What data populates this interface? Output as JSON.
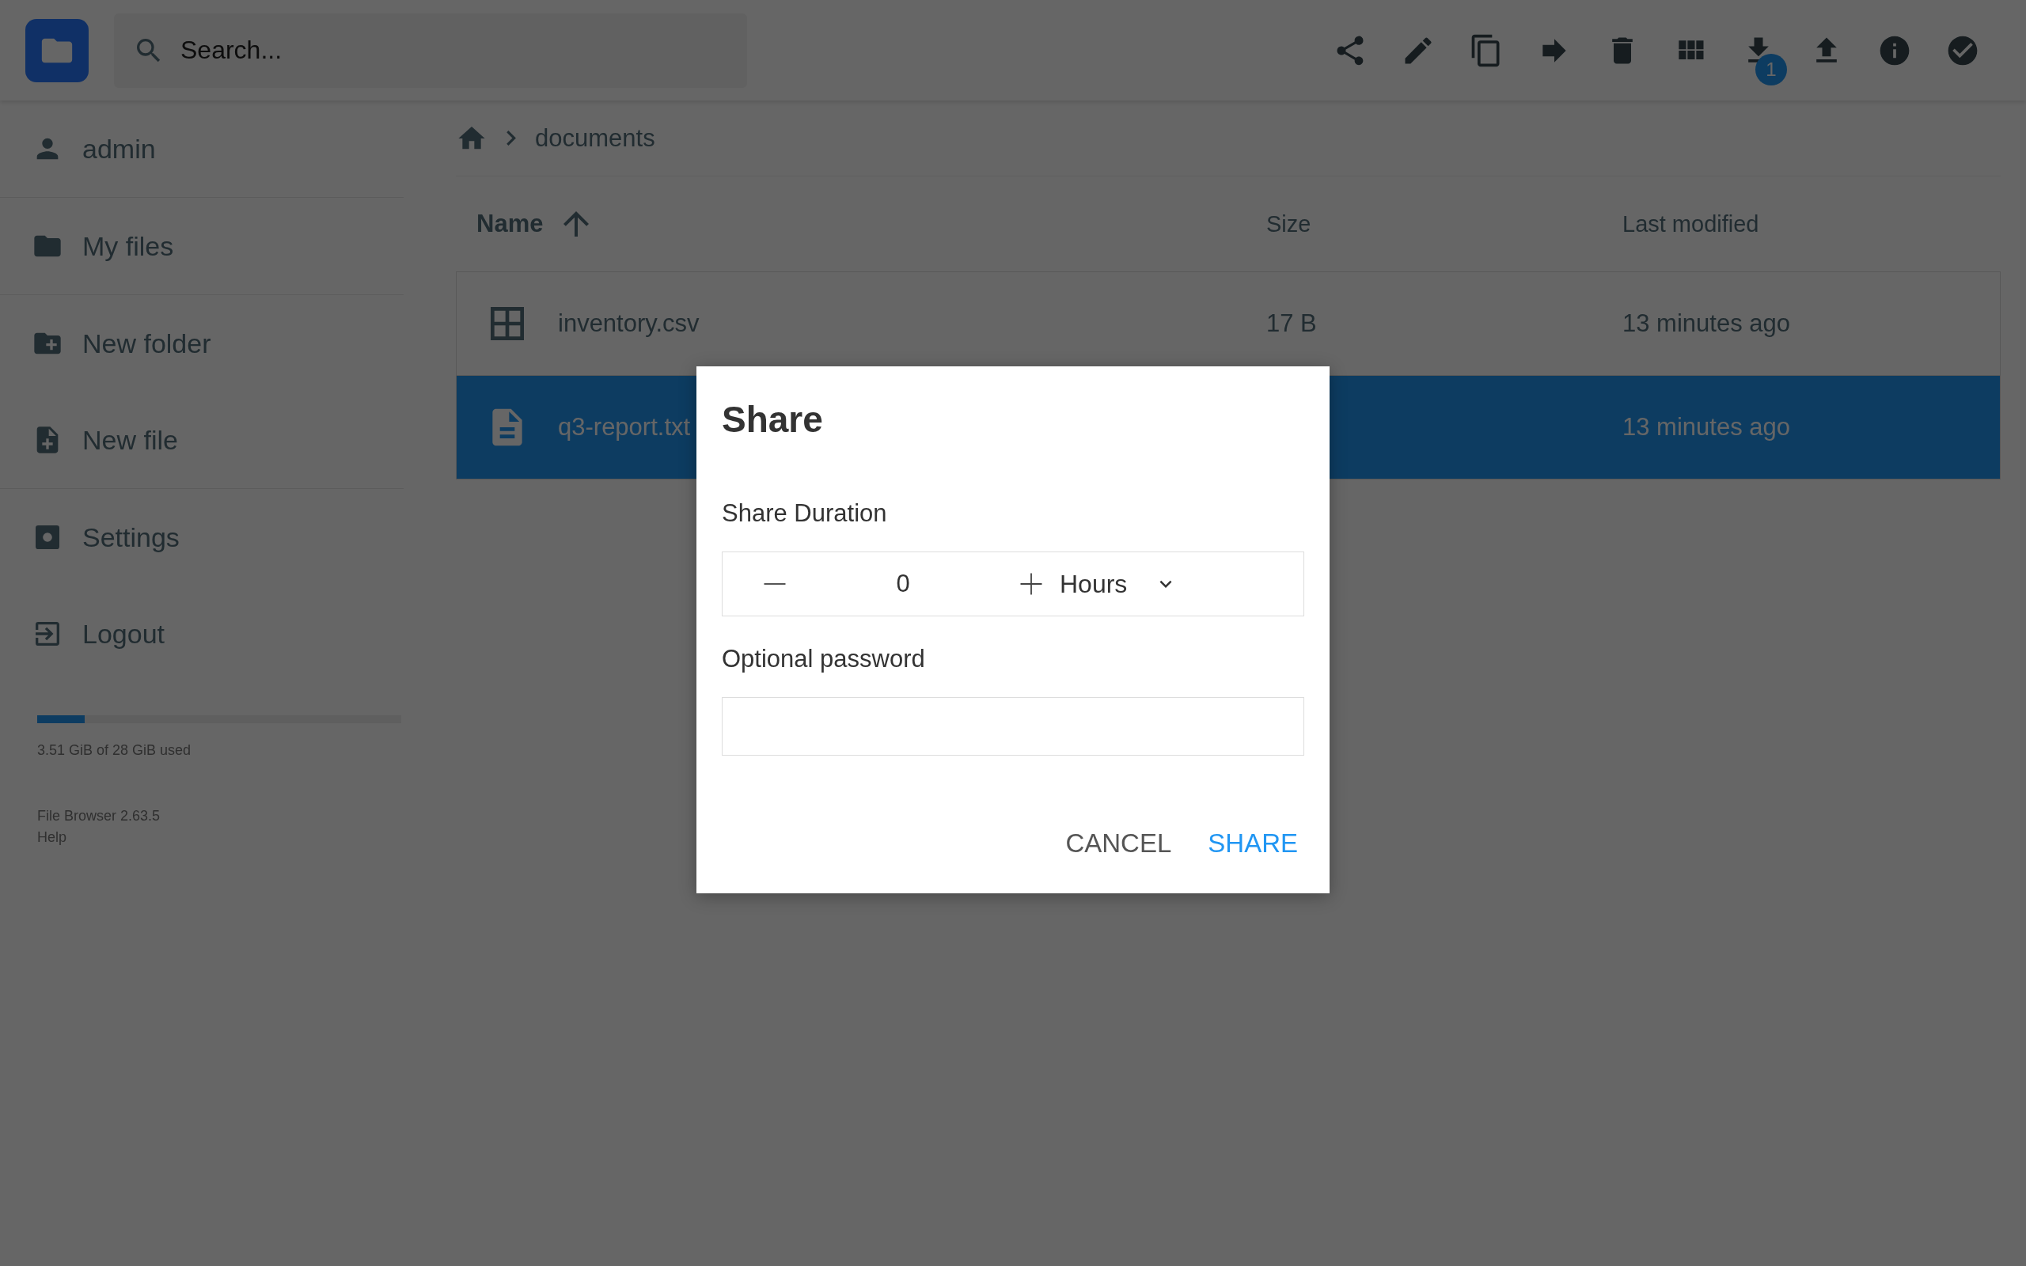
{
  "header": {
    "search": {
      "placeholder": "Search..."
    },
    "download_badge": "1"
  },
  "sidebar": {
    "user": "admin",
    "groups": [
      [
        {
          "label": "My files",
          "kind": "folder"
        }
      ],
      [
        {
          "label": "New folder",
          "kind": "new-folder"
        },
        {
          "label": "New file",
          "kind": "new-file"
        }
      ],
      [
        {
          "label": "Settings",
          "kind": "settings"
        },
        {
          "label": "Logout",
          "kind": "logout"
        }
      ]
    ],
    "storage": {
      "level": 0.13,
      "text": "3.51 GiB of 28 GiB used"
    },
    "footer": {
      "version": "File Browser 2.63.5",
      "help": "Help"
    }
  },
  "breadcrumb": [
    "documents"
  ],
  "table": {
    "columns": [
      {
        "label": "Name",
        "sorted": true
      },
      {
        "label": "Size",
        "sorted": false
      },
      {
        "label": "Last modified",
        "sorted": false
      }
    ],
    "rows": [
      {
        "name": "inventory.csv",
        "kind": "spreadsheet",
        "size": "17 B",
        "modified": "13 minutes ago",
        "selected": false
      },
      {
        "name": "q3-report.txt",
        "kind": "text",
        "modified": "13 minutes ago",
        "selected": true
      }
    ]
  },
  "dialog": {
    "title": "Share",
    "duration_label": "Share Duration",
    "duration_value": "0",
    "unit": "Hours",
    "password_label": "Optional password",
    "buttons": [
      {
        "label": "CANCEL",
        "primary": false
      },
      {
        "label": "SHARE",
        "primary": true
      }
    ]
  }
}
